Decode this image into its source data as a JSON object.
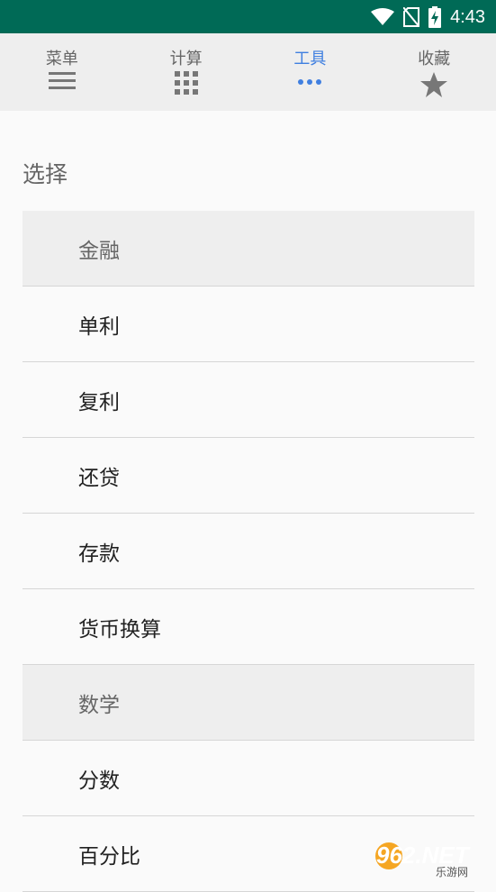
{
  "status_bar": {
    "time": "4:43",
    "background": "#006a56"
  },
  "tabs": [
    {
      "label": "菜单",
      "icon": "menu-icon",
      "active": false
    },
    {
      "label": "计算",
      "icon": "grid-icon",
      "active": false
    },
    {
      "label": "工具",
      "icon": "more-dots-icon",
      "active": true
    },
    {
      "label": "收藏",
      "icon": "star-icon",
      "active": false
    }
  ],
  "accent_color": "#3f7fe0",
  "content": {
    "title": "选择",
    "items": [
      {
        "label": "金融",
        "type": "header"
      },
      {
        "label": "单利",
        "type": "item"
      },
      {
        "label": "复利",
        "type": "item"
      },
      {
        "label": "还贷",
        "type": "item"
      },
      {
        "label": "存款",
        "type": "item"
      },
      {
        "label": "货币换算",
        "type": "item"
      },
      {
        "label": "数学",
        "type": "header"
      },
      {
        "label": "分数",
        "type": "item"
      },
      {
        "label": "百分比",
        "type": "item"
      }
    ]
  },
  "watermark": {
    "text": "962.NET",
    "subtext": "乐游网"
  }
}
